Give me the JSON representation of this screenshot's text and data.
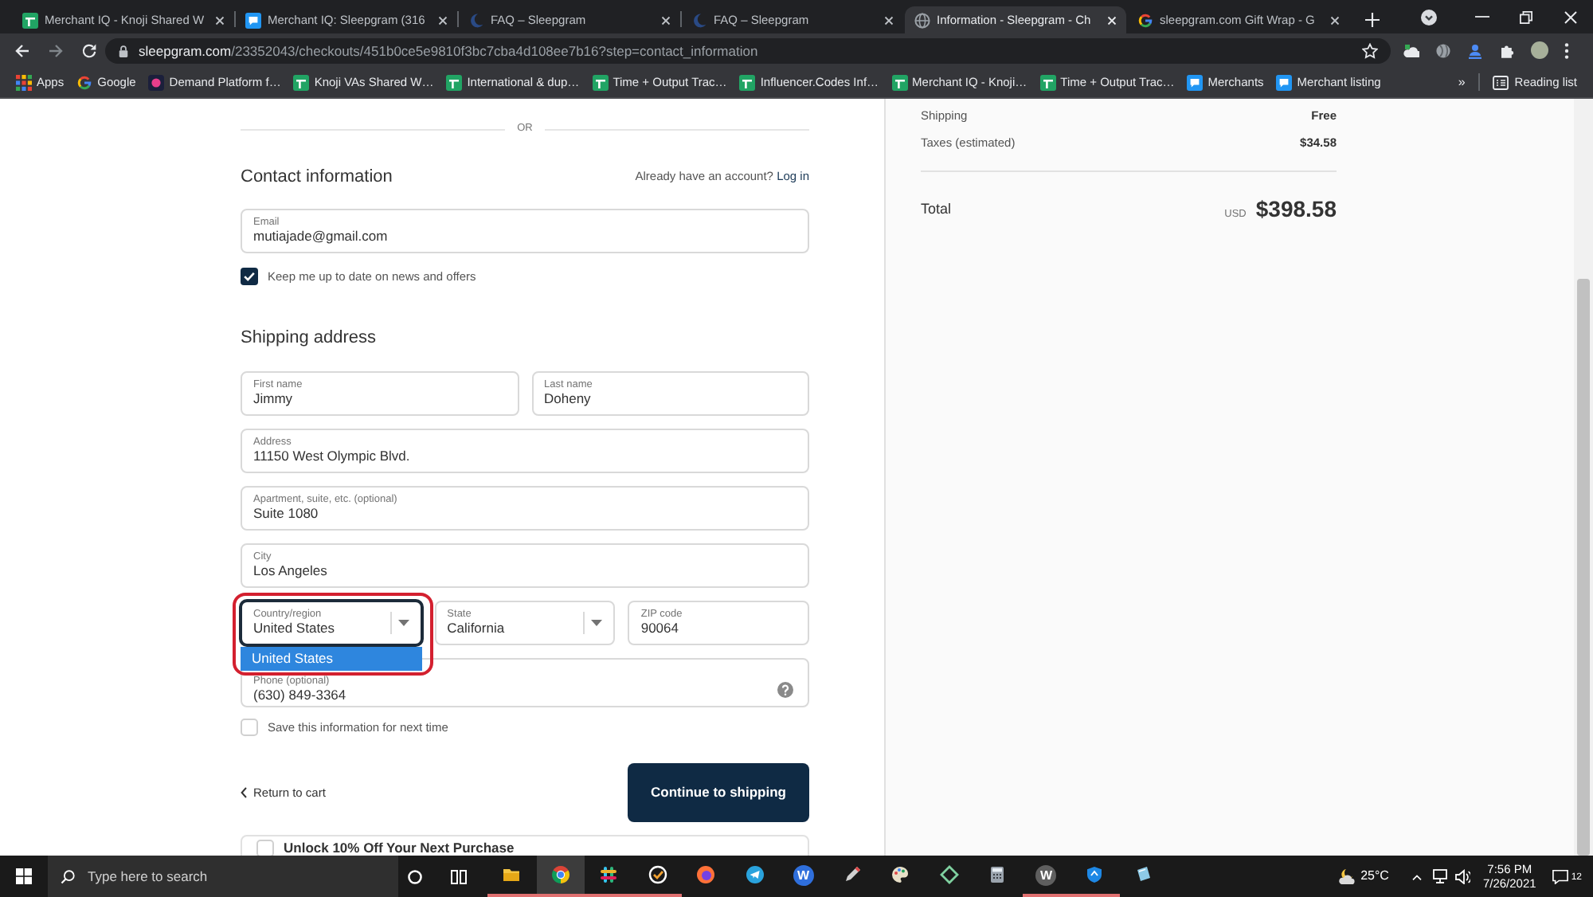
{
  "tabs": [
    {
      "title": "Merchant IQ - Knoji Shared W",
      "kind": "sheet",
      "selected": false
    },
    {
      "title": "Merchant IQ: Sleepgram (316",
      "kind": "chat",
      "selected": false
    },
    {
      "title": "FAQ – Sleepgram",
      "kind": "site",
      "selected": false
    },
    {
      "title": "FAQ – Sleepgram",
      "kind": "site",
      "selected": false
    },
    {
      "title": "Information - Sleepgram - Ch",
      "kind": "globe",
      "selected": true
    },
    {
      "title": "sleepgram.com Gift Wrap - G",
      "kind": "google",
      "selected": false
    }
  ],
  "address_bar": {
    "domain": "sleepgram.com",
    "path": "/23352043/checkouts/451b0ce5e9810f3bc7cba4d108ee7b16?step=contact_information"
  },
  "bookmarks": [
    {
      "label": "Apps",
      "kind": "apps"
    },
    {
      "label": "Google",
      "kind": "google"
    },
    {
      "label": "Demand Platform f…",
      "kind": "logo"
    },
    {
      "label": "Knoji VAs Shared W…",
      "kind": "sheet"
    },
    {
      "label": "International & dup…",
      "kind": "sheet"
    },
    {
      "label": "Time + Output Trac…",
      "kind": "sheet"
    },
    {
      "label": "Influencer.Codes Inf…",
      "kind": "sheet"
    },
    {
      "label": "Merchant IQ - Knoji…",
      "kind": "sheet"
    },
    {
      "label": "Time + Output Trac…",
      "kind": "sheet"
    },
    {
      "label": "Merchants",
      "kind": "chat"
    },
    {
      "label": "Merchant listing",
      "kind": "chat"
    }
  ],
  "bookmarks_overflow": "»",
  "reading_list": "Reading list",
  "checkout": {
    "divider_label": "OR",
    "contact_heading": "Contact information",
    "account_prompt": "Already have an account?",
    "login_link": "Log in",
    "email": {
      "label": "Email",
      "value": "mutiajade@gmail.com"
    },
    "newsletter": {
      "label": "Keep me up to date on news and offers",
      "checked": true
    },
    "shipping_heading": "Shipping address",
    "address_rows": [
      {
        "fields": [
          {
            "label": "First name",
            "value": "Jimmy",
            "kind": "text",
            "focused": false,
            "highlighted": false
          },
          {
            "label": "Last name",
            "value": "Doheny",
            "kind": "text",
            "focused": false,
            "highlighted": false
          }
        ]
      },
      {
        "fields": [
          {
            "label": "Address",
            "value": "11150 West Olympic Blvd.",
            "kind": "text",
            "focused": false,
            "highlighted": false
          }
        ]
      },
      {
        "fields": [
          {
            "label": "Apartment, suite, etc. (optional)",
            "value": "Suite 1080",
            "kind": "text",
            "focused": false,
            "highlighted": false
          }
        ]
      },
      {
        "fields": [
          {
            "label": "City",
            "value": "Los Angeles",
            "kind": "text",
            "focused": false,
            "highlighted": false
          }
        ]
      },
      {
        "fields": [
          {
            "label": "Country/region",
            "value": "United States",
            "kind": "select",
            "focused": true,
            "highlighted": true,
            "options": [
              {
                "label": "United States",
                "selected": true
              }
            ]
          },
          {
            "label": "State",
            "value": "California",
            "kind": "select",
            "focused": false,
            "highlighted": false
          },
          {
            "label": "ZIP code",
            "value": "90064",
            "kind": "text",
            "focused": false,
            "highlighted": false
          }
        ]
      },
      {
        "fields": [
          {
            "label": "Phone (optional)",
            "value": "(630) 849-3364",
            "kind": "help",
            "focused": false,
            "highlighted": false
          }
        ]
      }
    ],
    "save_info": {
      "label": "Save this information for next time",
      "checked": false
    },
    "return_link": "Return to cart",
    "continue_button": "Continue to shipping",
    "offer": {
      "label": "Unlock 10% Off Your Next Purchase",
      "checked": false
    }
  },
  "order_summary": {
    "lines": [
      {
        "label": "Shipping",
        "value": "Free"
      },
      {
        "label": "Taxes (estimated)",
        "value": "$34.58"
      }
    ],
    "total": {
      "label": "Total",
      "currency": "USD",
      "amount": "$398.58"
    }
  },
  "taskbar": {
    "search_placeholder": "Type here to search",
    "apps": [
      {
        "kind": "folder",
        "running": true,
        "active": false
      },
      {
        "kind": "browser",
        "running": true,
        "active": true
      },
      {
        "kind": "hash",
        "running": true,
        "active": false
      },
      {
        "kind": "check",
        "running": true,
        "active": false
      },
      {
        "kind": "orb",
        "running": false,
        "active": false
      },
      {
        "kind": "plane",
        "running": false,
        "active": false
      },
      {
        "kind": "letter",
        "letter": "W",
        "color": "#2f6fdc",
        "running": false,
        "active": false
      },
      {
        "kind": "pen",
        "running": false,
        "active": false
      },
      {
        "kind": "palette",
        "running": false,
        "active": false
      },
      {
        "kind": "diamond",
        "running": false,
        "active": false
      },
      {
        "kind": "calculator",
        "running": false,
        "active": false
      },
      {
        "kind": "letter",
        "letter": "W",
        "color": "#5f5f5f",
        "running": true,
        "active": false
      },
      {
        "kind": "shield",
        "running": true,
        "active": false
      },
      {
        "kind": "notebook",
        "running": false,
        "active": false
      }
    ],
    "temperature": "25°C",
    "time": "7:56 PM",
    "date": "7/26/2021",
    "notifications": "12"
  }
}
